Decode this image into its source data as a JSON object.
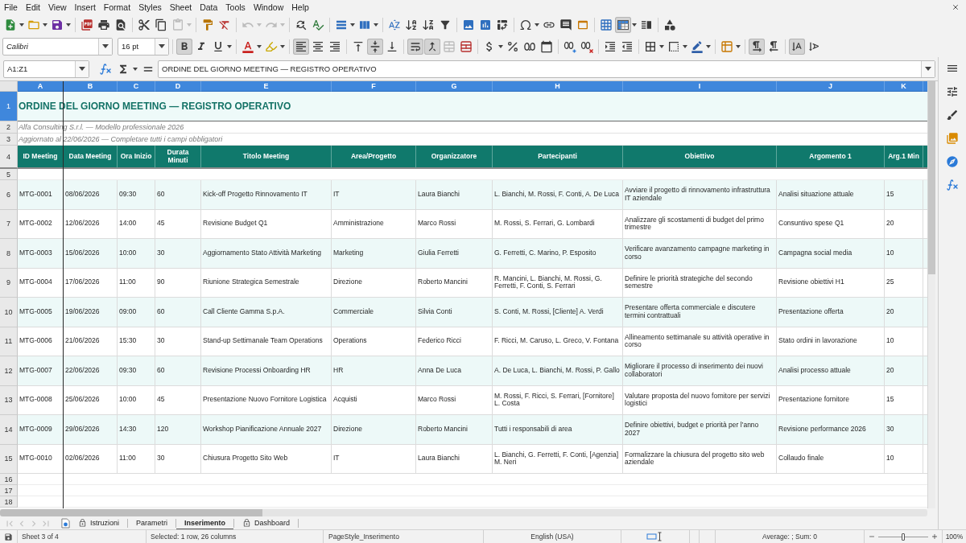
{
  "menu_bar": {
    "items": [
      "File",
      "Edit",
      "View",
      "Insert",
      "Format",
      "Styles",
      "Sheet",
      "Data",
      "Tools",
      "Window",
      "Help"
    ]
  },
  "standard_toolbar": {
    "paste_disabled": true,
    "undo_disabled": true,
    "redo_disabled": true,
    "freeze_rows_columns": true
  },
  "formatting_toolbar": {
    "font_name": "Calibri",
    "font_size": "16 pt",
    "bold": true,
    "italic": false,
    "underline": false,
    "align_left": true,
    "align_center": false,
    "align_right": false,
    "align_top": false,
    "align_middle": true,
    "align_bottom": false,
    "wrap_text": true,
    "merge_and_center": true,
    "merge_cells_disabled": true,
    "left_to_right": true,
    "right_to_left": false,
    "vertical_text": true,
    "rotated_text": false
  },
  "formula_bar": {
    "name_box": "A1:Z1",
    "formula": "ORDINE DEL GIORNO MEETING — REGISTRO OPERATIVO"
  },
  "sheet": {
    "column_letters": [
      {
        "label": "A",
        "selected": true
      },
      {
        "label": "B",
        "selected": true
      },
      {
        "label": "C",
        "selected": true
      },
      {
        "label": "D",
        "selected": true
      },
      {
        "label": "E",
        "selected": true
      },
      {
        "label": "F",
        "selected": true
      },
      {
        "label": "G",
        "selected": true
      },
      {
        "label": "H",
        "selected": true
      },
      {
        "label": "I",
        "selected": true
      },
      {
        "label": "J",
        "selected": true
      },
      {
        "label": "K",
        "selected": true
      }
    ],
    "row_numbers": [
      {
        "label": "1",
        "selected": true
      },
      {
        "label": "2",
        "selected": false
      },
      {
        "label": "3",
        "selected": false
      },
      {
        "label": "4",
        "selected": false
      },
      {
        "label": "5",
        "selected": false
      },
      {
        "label": "6",
        "selected": false
      },
      {
        "label": "7",
        "selected": false
      },
      {
        "label": "8",
        "selected": false
      },
      {
        "label": "9",
        "selected": false
      },
      {
        "label": "10",
        "selected": false
      },
      {
        "label": "11",
        "selected": false
      },
      {
        "label": "12",
        "selected": false
      },
      {
        "label": "13",
        "selected": false
      },
      {
        "label": "14",
        "selected": false
      },
      {
        "label": "15",
        "selected": false
      },
      {
        "label": "16",
        "selected": false
      },
      {
        "label": "17",
        "selected": false
      },
      {
        "label": "18",
        "selected": false
      }
    ],
    "title": "ORDINE DEL GIORNO MEETING — REGISTRO OPERATIVO",
    "subtitle_lines": [
      "Alfa Consulting S.r.l. — Modello professionale 2026",
      "Aggiornato al 22/06/2026 — Completare tutti i campi obbligatori"
    ],
    "table": {
      "columns": [
        "ID Meeting",
        "Data Meeting",
        "Ora Inizio",
        "Durata Minuti",
        "Titolo Meeting",
        "Area/Progetto",
        "Organizzatore",
        "Partecipanti",
        "Obiettivo",
        "Argomento 1",
        "Arg.1 Min"
      ],
      "rows": [
        [
          "MTG-0001",
          "08/06/2026",
          "09:30",
          "60",
          "Kick-off Progetto Rinnovamento IT",
          "IT",
          "Laura Bianchi",
          "L. Bianchi, M. Rossi, F. Conti, A. De Luca",
          "Avviare il progetto di rinnovamento infrastruttura IT aziendale",
          "Analisi situazione attuale",
          "15"
        ],
        [
          "MTG-0002",
          "12/06/2026",
          "14:00",
          "45",
          "Revisione Budget Q1",
          "Amministrazione",
          "Marco Rossi",
          "M. Rossi, S. Ferrari, G. Lombardi",
          "Analizzare gli scostamenti di budget del primo trimestre",
          "Consuntivo spese Q1",
          "20"
        ],
        [
          "MTG-0003",
          "15/06/2026",
          "10:00",
          "30",
          "Aggiornamento Stato Attività Marketing",
          "Marketing",
          "Giulia Ferretti",
          "G. Ferretti, C. Marino, P. Esposito",
          "Verificare avanzamento campagne marketing in corso",
          "Campagna social media",
          "10"
        ],
        [
          "MTG-0004",
          "17/06/2026",
          "11:00",
          "90",
          "Riunione Strategica Semestrale",
          "Direzione",
          "Roberto Mancini",
          "R. Mancini, L. Bianchi, M. Rossi, G. Ferretti, F. Conti, S. Ferrari",
          "Definire le priorità strategiche del secondo semestre",
          "Revisione obiettivi H1",
          "25"
        ],
        [
          "MTG-0005",
          "19/06/2026",
          "09:00",
          "60",
          "Call Cliente Gamma S.p.A.",
          "Commerciale",
          "Silvia Conti",
          "S. Conti, M. Rossi, [Cliente] A. Verdi",
          "Presentare offerta commerciale e discutere termini contrattuali",
          "Presentazione offerta",
          "20"
        ],
        [
          "MTG-0006",
          "21/06/2026",
          "15:30",
          "30",
          "Stand-up Settimanale Team Operations",
          "Operations",
          "Federico Ricci",
          "F. Ricci, M. Caruso, L. Greco, V. Fontana",
          "Allineamento settimanale su attività operative in corso",
          "Stato ordini in lavorazione",
          "10"
        ],
        [
          "MTG-0007",
          "22/06/2026",
          "09:30",
          "60",
          "Revisione Processi Onboarding HR",
          "HR",
          "Anna De Luca",
          "A. De Luca, L. Bianchi, M. Rossi, P. Gallo",
          "Migliorare il processo di inserimento dei nuovi collaboratori",
          "Analisi processo attuale",
          "20"
        ],
        [
          "MTG-0008",
          "25/06/2026",
          "10:00",
          "45",
          "Presentazione Nuovo Fornitore Logistica",
          "Acquisti",
          "Marco Rossi",
          "M. Rossi, F. Ricci, S. Ferrari, [Fornitore] L. Costa",
          "Valutare proposta del nuovo fornitore per servizi logistici",
          "Presentazione fornitore",
          "15"
        ],
        [
          "MTG-0009",
          "29/06/2026",
          "14:30",
          "120",
          "Workshop Pianificazione Annuale 2027",
          "Direzione",
          "Roberto Mancini",
          "Tutti i responsabili di area",
          "Definire obiettivi, budget e priorità per l’anno 2027",
          "Revisione performance 2026",
          "30"
        ],
        [
          "MTG-0010",
          "02/06/2026",
          "11:00",
          "30",
          "Chiusura Progetto Sito Web",
          "IT",
          "Laura Bianchi",
          "L. Bianchi, G. Ferretti, F. Conti, [Agenzia] M. Neri",
          "Formalizzare la chiusura del progetto sito web aziendale",
          "Collaudo finale",
          "10"
        ]
      ]
    }
  },
  "sheet_tabs": {
    "navigation_disabled": true,
    "tabs": [
      {
        "label": "Istruzioni",
        "locked": true,
        "selected": false
      },
      {
        "label": "Parametri",
        "locked": false,
        "selected": false
      },
      {
        "label": "Inserimento",
        "locked": false,
        "selected": true
      },
      {
        "label": "Dashboard",
        "locked": true,
        "selected": false
      }
    ]
  },
  "status_bar": {
    "sheet_position": "Sheet 3 of 4",
    "selection": "Selected: 1 row, 26 columns",
    "page_style": "PageStyle_Inserimento",
    "language": "English (USA)",
    "summary": "Average: ; Sum: 0",
    "zoom": {
      "level": 0.5,
      "reading": "100%"
    }
  }
}
